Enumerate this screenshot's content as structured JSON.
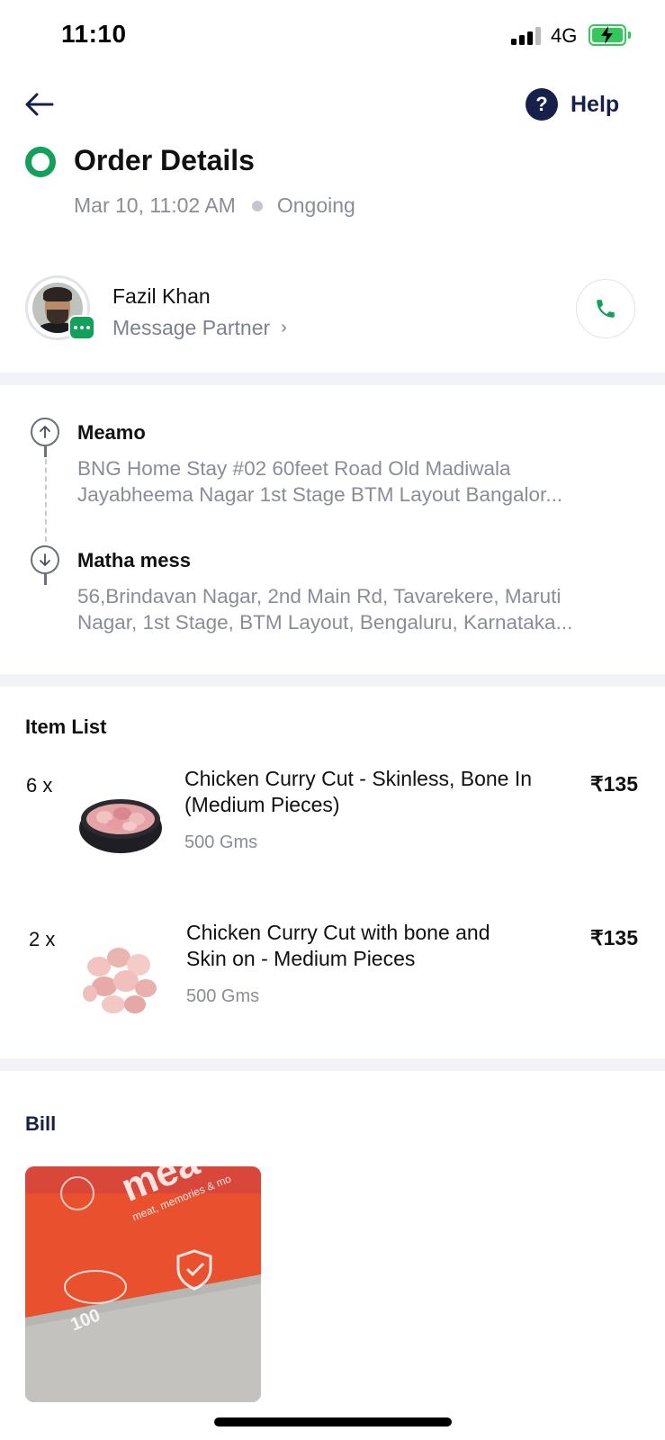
{
  "status_bar": {
    "time": "11:10",
    "network": "4G",
    "battery_icon": "battery-charging-icon",
    "signal_icon": "cellular-signal-icon"
  },
  "header": {
    "back_icon": "back-arrow-icon",
    "help_label": "Help",
    "help_icon": "question-circle-icon"
  },
  "order": {
    "title": "Order Details",
    "datetime": "Mar 10, 11:02 AM",
    "status": "Ongoing",
    "status_color": "#12a05a"
  },
  "partner": {
    "name": "Fazil Khan",
    "message_label": "Message Partner",
    "chevron": "›",
    "call_icon": "phone-icon",
    "badge_color": "#12a05a"
  },
  "route": {
    "pickup": {
      "name": "Meamo",
      "address_line1": "BNG Home Stay #02 60feet Road Old Madiwala",
      "address_line2": "Jayabheema Nagar 1st Stage BTM Layout Bangalor..."
    },
    "drop": {
      "name": "Matha mess",
      "address_line1": "56,Brindavan Nagar, 2nd Main Rd, Tavarekere, Maruti",
      "address_line2": "Nagar, 1st Stage, BTM Layout, Bengaluru, Karnataka..."
    }
  },
  "items": {
    "title": "Item List",
    "list": [
      {
        "qty": "6 x",
        "name_line1": "Chicken Curry Cut - Skinless, Bone In",
        "name_line2": "(Medium Pieces)",
        "weight": "500 Gms",
        "price": "₹135"
      },
      {
        "qty": "2 x",
        "name_line1": "Chicken Curry Cut with bone and",
        "name_line2": "Skin on - Medium Pieces",
        "weight": "500 Gms",
        "price": "₹135"
      }
    ]
  },
  "bill": {
    "title": "Bill",
    "image_logo_text": "mea",
    "image_tagline": "meat, memories & mo",
    "image_badge": "100"
  }
}
